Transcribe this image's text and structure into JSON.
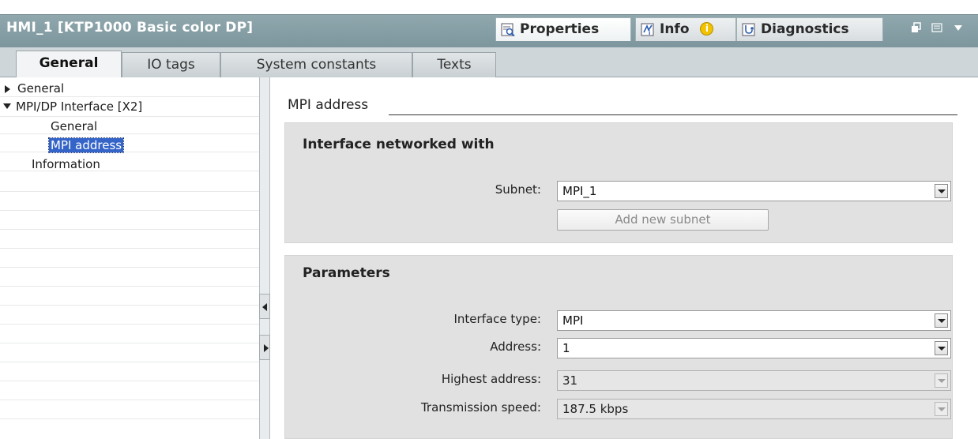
{
  "window": {
    "title": "HMI_1 [KTP1000 Basic color DP]",
    "tabs": [
      {
        "label": "Properties",
        "icon": "properties-icon",
        "active": true
      },
      {
        "label": "Info",
        "icon": "info-icon",
        "badge": "i"
      },
      {
        "label": "Diagnostics",
        "icon": "diagnostics-icon"
      }
    ]
  },
  "subtabs": [
    "General",
    "IO tags",
    "System constants",
    "Texts"
  ],
  "tree": {
    "items": [
      {
        "label": "General",
        "expander": "collapsed"
      },
      {
        "label": "MPI/DP Interface [X2]",
        "expander": "expanded"
      },
      {
        "label": "General"
      },
      {
        "label": "MPI address",
        "selected": true
      },
      {
        "label": "Information"
      }
    ]
  },
  "content": {
    "section_title": "MPI address",
    "networked": {
      "title": "Interface networked with",
      "subnet_label": "Subnet:",
      "subnet_value": "MPI_1",
      "add_subnet_button": "Add new subnet"
    },
    "parameters": {
      "title": "Parameters",
      "fields": [
        {
          "label": "Interface type:",
          "value": "MPI",
          "enabled": true
        },
        {
          "label": "Address:",
          "value": "1",
          "enabled": true
        },
        {
          "label": "Highest address:",
          "value": "31",
          "enabled": false
        },
        {
          "label": "Transmission speed:",
          "value": "187.5 kbps",
          "enabled": false
        }
      ]
    }
  },
  "colors": {
    "title_bar": "#7d969d",
    "selection": "#3464c8",
    "group_background": "#e1e1e1",
    "info_badge": "#f2c200"
  }
}
